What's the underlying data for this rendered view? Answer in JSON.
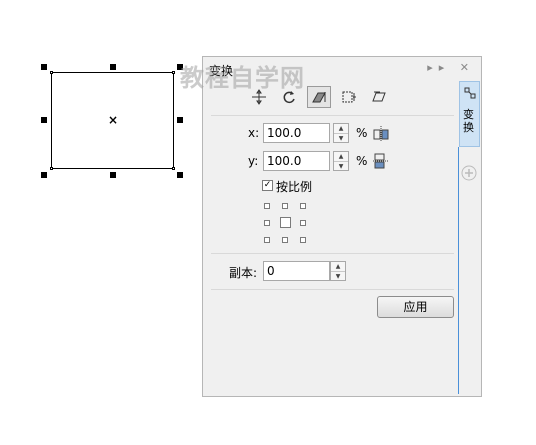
{
  "panel": {
    "title": "变换",
    "watermark": "教程自学网",
    "title_buttons": "▸▸ ✕",
    "vertical_tab": "变换",
    "x": {
      "label": "x:",
      "value": "100.0",
      "unit": "%"
    },
    "y": {
      "label": "y:",
      "value": "100.0",
      "unit": "%"
    },
    "proportional": {
      "label": "按比例",
      "checked": true
    },
    "copies": {
      "label": "副本:",
      "value": "0"
    },
    "apply_label": "应用"
  },
  "colors": {
    "accent": "#4a90d9",
    "tab_bg": "#cfe3f5"
  },
  "icons": [
    "position-icon",
    "rotate-icon",
    "scale-icon",
    "size-icon",
    "skew-icon",
    "mirror-h-icon",
    "mirror-v-icon",
    "plus-icon"
  ]
}
